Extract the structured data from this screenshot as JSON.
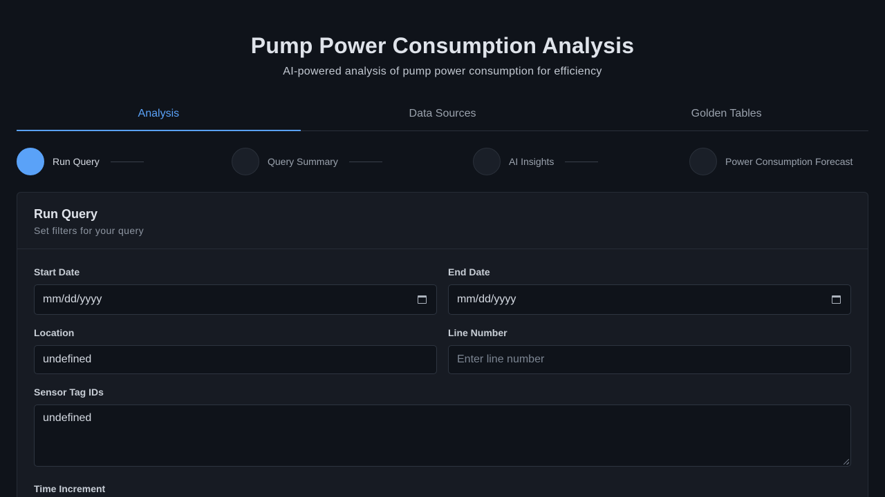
{
  "header": {
    "title": "Pump Power Consumption Analysis",
    "subtitle": "AI-powered analysis of pump power consumption for efficiency"
  },
  "tabs": [
    {
      "label": "Analysis",
      "active": true
    },
    {
      "label": "Data Sources",
      "active": false
    },
    {
      "label": "Golden Tables",
      "active": false
    }
  ],
  "steps": [
    {
      "label": "Run Query",
      "active": true
    },
    {
      "label": "Query Summary",
      "active": false
    },
    {
      "label": "AI Insights",
      "active": false
    },
    {
      "label": "Power Consumption Forecast",
      "active": false
    }
  ],
  "card": {
    "title": "Run Query",
    "subtitle": "Set filters for your query"
  },
  "form": {
    "start_date": {
      "label": "Start Date",
      "value": "mm/dd/yyyy"
    },
    "end_date": {
      "label": "End Date",
      "value": "mm/dd/yyyy"
    },
    "location": {
      "label": "Location",
      "value": "undefined"
    },
    "line_number": {
      "label": "Line Number",
      "placeholder": "Enter line number"
    },
    "sensor_tags": {
      "label": "Sensor Tag IDs",
      "value": "undefined"
    },
    "time_increment": {
      "label": "Time Increment"
    }
  },
  "colors": {
    "background": "#0f131a",
    "accent": "#5aa2f8",
    "card": "#171b23"
  }
}
